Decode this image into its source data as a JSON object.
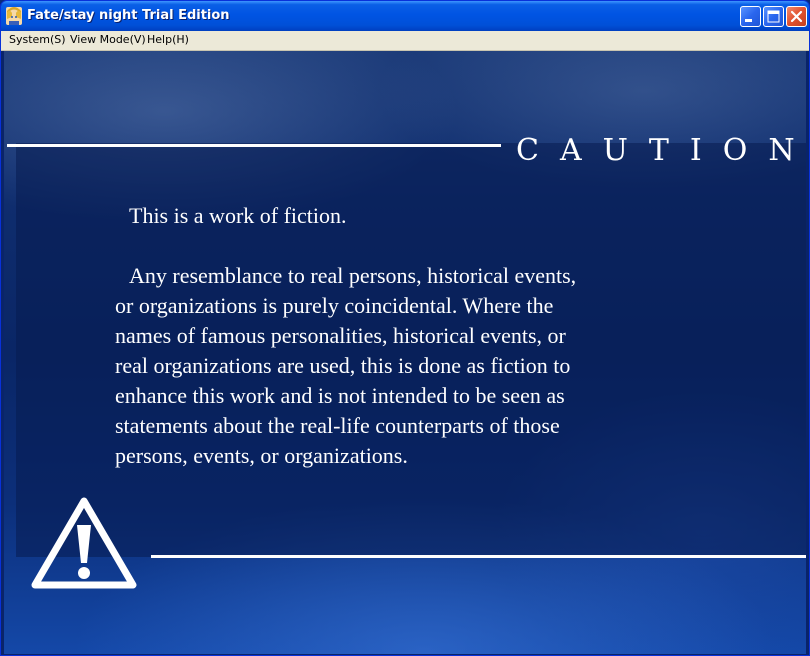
{
  "window": {
    "title": "Fate/stay night Trial Edition"
  },
  "menubar": {
    "items": [
      {
        "label": "System(S)"
      },
      {
        "label": "View Mode(V)"
      },
      {
        "label": "Help(H)"
      }
    ]
  },
  "caution": {
    "heading": "CAUTION",
    "paragraph1": "This is a work of fiction.",
    "paragraph2_lines": [
      "Any resemblance to real persons, historical events,",
      "or organizations is purely coincidental.  Where the",
      "names of famous personalities, historical events, or",
      "real organizations are used, this is done as fiction to",
      "enhance this work and is not intended to be seen as",
      "statements about the real-life counterparts of those",
      "persons, events, or organizations."
    ]
  },
  "icons": {
    "app": "saber-portrait-icon",
    "minimize": "minimize-icon",
    "maximize": "maximize-icon",
    "close": "close-icon",
    "warning": "warning-triangle-icon"
  },
  "colors": {
    "titlebar": "#0054e3",
    "menubar": "#ece9d8",
    "background": "#0a2666",
    "text": "#ffffff",
    "close_button": "#e0512e"
  }
}
